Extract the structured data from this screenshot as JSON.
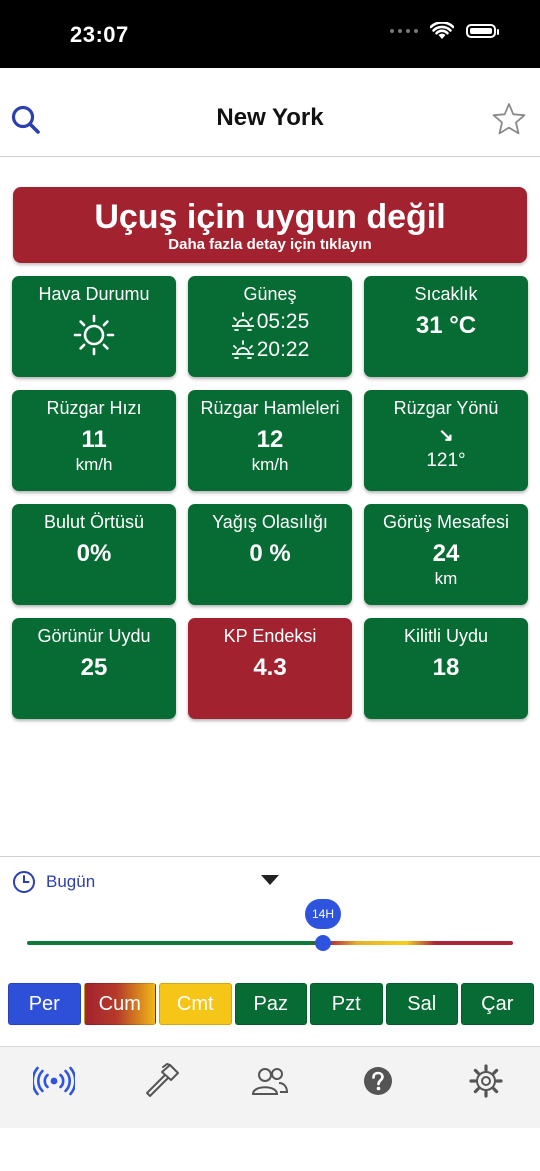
{
  "status_bar": {
    "time": "23:07"
  },
  "nav": {
    "title": "New York",
    "search_icon": "search-icon",
    "favorite_icon": "star-icon"
  },
  "alert": {
    "title": "Uçuş için uygun değil",
    "subtitle": "Daha fazla detay için tıklayın",
    "color": "#a2232f"
  },
  "tiles": {
    "weather": {
      "label": "Hava Durumu",
      "icon": "sun-icon"
    },
    "sun": {
      "label": "Güneş",
      "sunrise": "05:25",
      "sunset": "20:22"
    },
    "temperature": {
      "label": "Sıcaklık",
      "value": "31 °C"
    },
    "wind_speed": {
      "label": "Rüzgar Hızı",
      "value": "11",
      "unit": "km/h"
    },
    "wind_gusts": {
      "label": "Rüzgar Hamleleri",
      "value": "12",
      "unit": "km/h"
    },
    "wind_direction": {
      "label": "Rüzgar Yönü",
      "arrow": "↘",
      "value": "121°"
    },
    "cloud_cover": {
      "label": "Bulut Örtüsü",
      "value": "0%"
    },
    "precipitation": {
      "label": "Yağış Olasılığı",
      "value": "0 %"
    },
    "visibility": {
      "label": "Görüş Mesafesi",
      "value": "24",
      "unit": "km"
    },
    "visible_sats": {
      "label": "Görünür Uydu",
      "value": "25"
    },
    "kp_index": {
      "label": "KP Endeksi",
      "value": "4.3"
    },
    "locked_sats": {
      "label": "Kilitli Uydu",
      "value": "18"
    }
  },
  "colors": {
    "good": "#076b34",
    "bad": "#a2232f",
    "accent": "#2e53de",
    "warning": "#f5c518"
  },
  "timeline": {
    "day_label": "Bugün",
    "hour_label": "14H",
    "days": [
      {
        "label": "Per",
        "status": "selected"
      },
      {
        "label": "Cum",
        "status": "mixed"
      },
      {
        "label": "Cmt",
        "status": "warning"
      },
      {
        "label": "Paz",
        "status": "good"
      },
      {
        "label": "Pzt",
        "status": "good"
      },
      {
        "label": "Sal",
        "status": "good"
      },
      {
        "label": "Çar",
        "status": "good"
      }
    ]
  },
  "tabbar": {
    "items": [
      {
        "icon": "broadcast-icon",
        "active": true
      },
      {
        "icon": "hammer-icon",
        "active": false
      },
      {
        "icon": "users-icon",
        "active": false
      },
      {
        "icon": "help-icon",
        "active": false
      },
      {
        "icon": "settings-gear-icon",
        "active": false
      }
    ]
  }
}
